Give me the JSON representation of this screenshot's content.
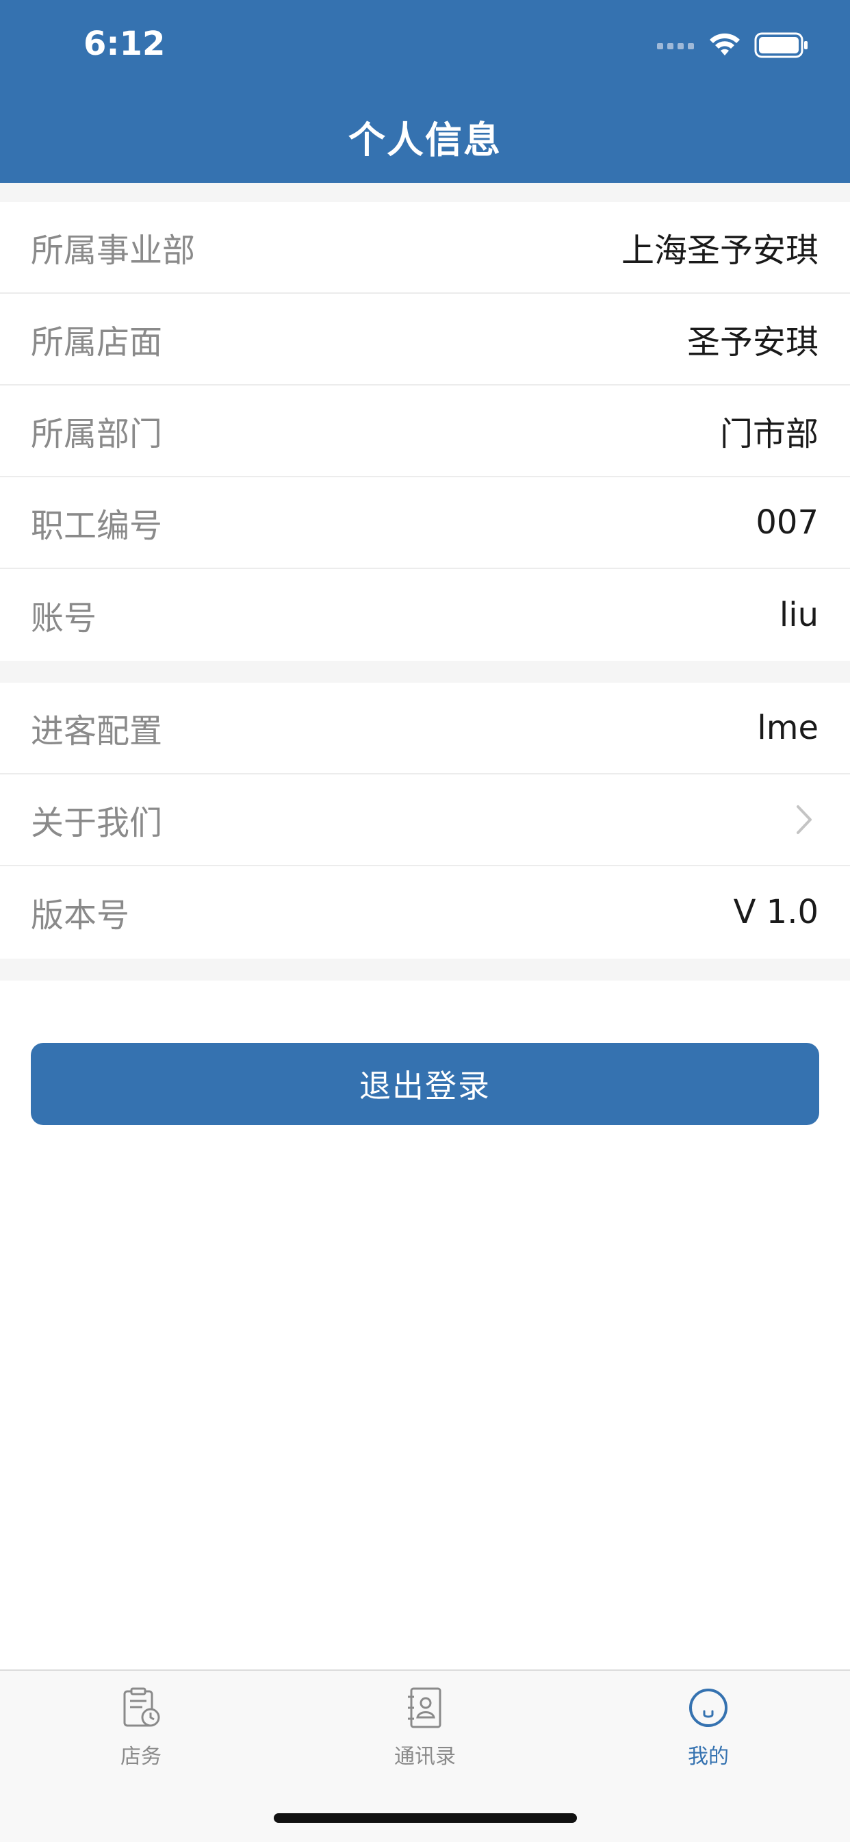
{
  "status_bar": {
    "time": "6:12"
  },
  "header": {
    "title": "个人信息"
  },
  "profile_rows": [
    {
      "label": "所属事业部",
      "value": "上海圣予安琪"
    },
    {
      "label": "所属店面",
      "value": "圣予安琪"
    },
    {
      "label": "所属部门",
      "value": "门市部"
    },
    {
      "label": "职工编号",
      "value": "007"
    },
    {
      "label": "账号",
      "value": "liu"
    }
  ],
  "settings_rows": [
    {
      "label": "进客配置",
      "value": "lme"
    },
    {
      "label": "关于我们",
      "icon": "chevron-right-icon"
    },
    {
      "label": "版本号",
      "value": "V 1.0"
    }
  ],
  "logout_button": {
    "label": "退出登录"
  },
  "tabbar": {
    "tabs": [
      {
        "label": "店务",
        "icon": "clipboard-clock-icon",
        "active": false
      },
      {
        "label": "通讯录",
        "icon": "contacts-book-icon",
        "active": false
      },
      {
        "label": "我的",
        "icon": "smile-face-icon",
        "active": true
      }
    ]
  },
  "colors": {
    "primary": "#3572b0",
    "label_gray": "#8a8a8a",
    "separator": "#ececec",
    "section_gap": "#f5f5f5"
  }
}
